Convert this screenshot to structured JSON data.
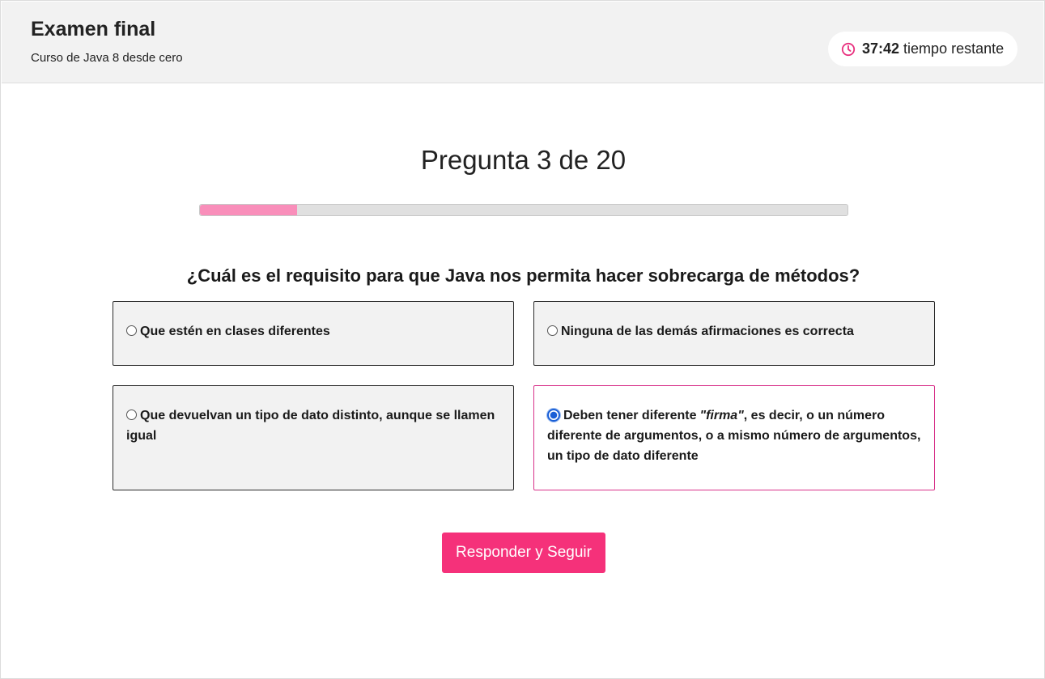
{
  "header": {
    "title": "Examen final",
    "course": "Curso de Java 8 desde cero"
  },
  "timer": {
    "icon": "clock-icon",
    "value": "37:42",
    "label": "tiempo restante",
    "accent_color": "#e8307e"
  },
  "quiz": {
    "counter": "Pregunta 3 de 20",
    "progress_percent": 15,
    "progress_color": "#f98eba",
    "question": "¿Cuál es el requisito para que Java nos permita hacer sobrecarga de métodos?",
    "options": [
      {
        "text": "Que estén en clases diferentes",
        "selected": false
      },
      {
        "text": "Ninguna de las demás afirmaciones es correcta",
        "selected": false
      },
      {
        "text": "Que devuelvan un tipo de dato distinto, aunque se llamen igual",
        "selected": false
      },
      {
        "text_before": "Deben tener diferente",
        "text_italic": "\"firma\"",
        "text_after": ", es decir, o un número diferente de argumentos, o a mismo número de argumentos, un tipo de dato diferente",
        "selected": true
      }
    ],
    "submit_label": "Responder y Seguir",
    "submit_color": "#f5317a"
  }
}
